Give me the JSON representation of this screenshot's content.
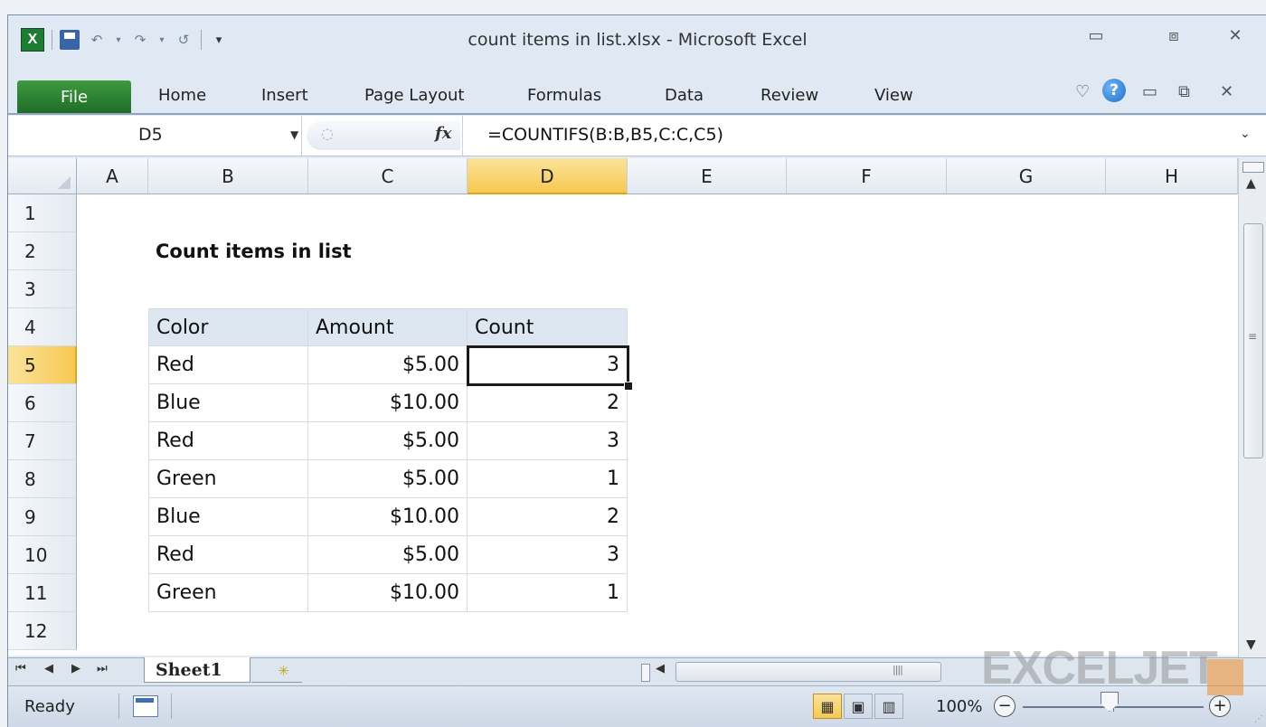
{
  "window": {
    "title": "count items in list.xlsx - Microsoft Excel",
    "controls": {
      "minimize": "▭",
      "maximize": "⧈",
      "close": "✕"
    }
  },
  "ribbon": {
    "file_tab": "File",
    "tabs": [
      "Home",
      "Insert",
      "Page Layout",
      "Formulas",
      "Data",
      "Review",
      "View"
    ]
  },
  "formula_bar": {
    "name_box": "D5",
    "fx_label": "fx",
    "formula": "=COUNTIFS(B:B,B5,C:C,C5)"
  },
  "grid": {
    "columns": [
      "A",
      "B",
      "C",
      "D",
      "E",
      "F",
      "G",
      "H"
    ],
    "rows": [
      "1",
      "2",
      "3",
      "4",
      "5",
      "6",
      "7",
      "8",
      "9",
      "10",
      "11",
      "12"
    ],
    "selected_cell": "D5",
    "sheet_title": "Count items in list",
    "table": {
      "headers": [
        "Color",
        "Amount",
        "Count"
      ],
      "rows": [
        [
          "Red",
          "$5.00",
          "3"
        ],
        [
          "Blue",
          "$10.00",
          "2"
        ],
        [
          "Red",
          "$5.00",
          "3"
        ],
        [
          "Green",
          "$5.00",
          "1"
        ],
        [
          "Blue",
          "$10.00",
          "2"
        ],
        [
          "Red",
          "$5.00",
          "3"
        ],
        [
          "Green",
          "$10.00",
          "1"
        ]
      ]
    }
  },
  "sheet_tabs": {
    "active": "Sheet1"
  },
  "status_bar": {
    "status": "Ready",
    "zoom": "100%"
  },
  "watermark": "EXCELJET",
  "colors": {
    "file_tab": "#2d7d33",
    "selected_header": "#f6c851",
    "table_header_fill": "#dde7f2"
  }
}
